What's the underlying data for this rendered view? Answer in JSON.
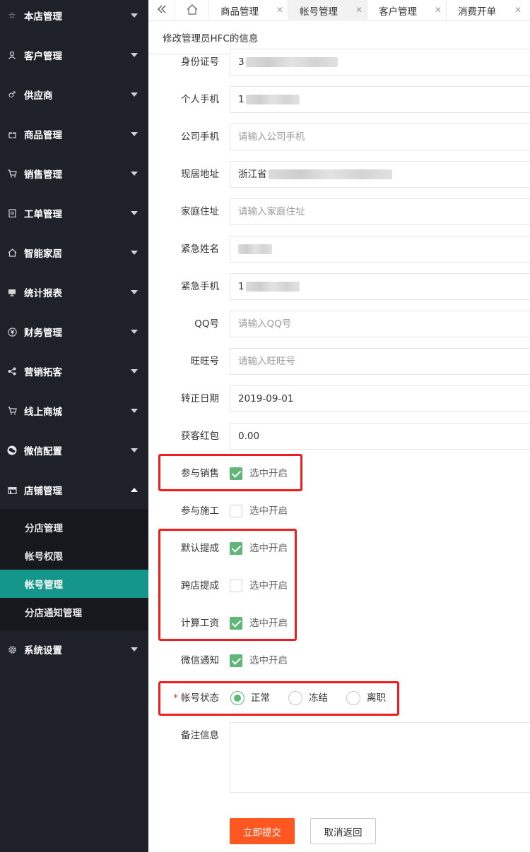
{
  "sidebar": {
    "items": [
      {
        "label": "本店管理",
        "icon": "star-icon"
      },
      {
        "label": "客户管理",
        "icon": "user-icon"
      },
      {
        "label": "供应商",
        "icon": "male-icon"
      },
      {
        "label": "商品管理",
        "icon": "gift-icon"
      },
      {
        "label": "销售管理",
        "icon": "cart-icon"
      },
      {
        "label": "工单管理",
        "icon": "clipboard-icon"
      },
      {
        "label": "智能家居",
        "icon": "home-icon"
      },
      {
        "label": "统计报表",
        "icon": "monitor-icon"
      },
      {
        "label": "财务管理",
        "icon": "yen-icon"
      },
      {
        "label": "营销拓客",
        "icon": "share-icon"
      },
      {
        "label": "线上商城",
        "icon": "cart-icon"
      },
      {
        "label": "微信配置",
        "icon": "wechat-icon"
      },
      {
        "label": "店铺管理",
        "icon": "store-icon"
      },
      {
        "label": "系统设置",
        "icon": "gear-icon"
      }
    ],
    "submenu": [
      {
        "label": "分店管理"
      },
      {
        "label": "帐号权限"
      },
      {
        "label": "帐号管理"
      },
      {
        "label": "分店通知管理"
      }
    ]
  },
  "tabs": [
    {
      "label": "商品管理"
    },
    {
      "label": "帐号管理"
    },
    {
      "label": "客户管理"
    },
    {
      "label": "消费开单"
    }
  ],
  "page_title": "修改管理员HFC的信息",
  "form": {
    "id_card": {
      "label": "身份证号",
      "value": "3"
    },
    "mobile": {
      "label": "个人手机",
      "value": "1"
    },
    "company_mobile": {
      "label": "公司手机",
      "placeholder": "请输入公司手机"
    },
    "address": {
      "label": "现居地址",
      "value": "浙江省"
    },
    "home_address": {
      "label": "家庭住址",
      "placeholder": "请输入家庭住址"
    },
    "emergency_name": {
      "label": "紧急姓名"
    },
    "emergency_mobile": {
      "label": "紧急手机",
      "value": "1"
    },
    "qq": {
      "label": "QQ号",
      "placeholder": "请输入QQ号"
    },
    "wangwang": {
      "label": "旺旺号",
      "placeholder": "请输入旺旺号"
    },
    "regular_date": {
      "label": "转正日期",
      "value": "2019-09-01"
    },
    "red_packet": {
      "label": "获客红包",
      "value": "0.00"
    },
    "checks": [
      {
        "label": "参与销售",
        "text": "选中开启",
        "checked": true
      },
      {
        "label": "参与施工",
        "text": "选中开启",
        "checked": false
      },
      {
        "label": "默认提成",
        "text": "选中开启",
        "checked": true
      },
      {
        "label": "跨店提成",
        "text": "选中开启",
        "checked": false
      },
      {
        "label": "计算工资",
        "text": "选中开启",
        "checked": true
      },
      {
        "label": "微信通知",
        "text": "选中开启",
        "checked": true
      }
    ],
    "status": {
      "required_mark": "*",
      "label": "帐号状态",
      "options": [
        "正常",
        "冻结",
        "离职"
      ],
      "selected": "正常"
    },
    "remark": {
      "label": "备注信息"
    },
    "submit_label": "立即提交",
    "cancel_label": "取消返回"
  },
  "colors": {
    "sidebar_bg": "#1f2129",
    "active_submenu": "#15968b",
    "check_green": "#5fb878",
    "primary_button": "#ff5722",
    "highlight_red": "#f01d1d"
  }
}
